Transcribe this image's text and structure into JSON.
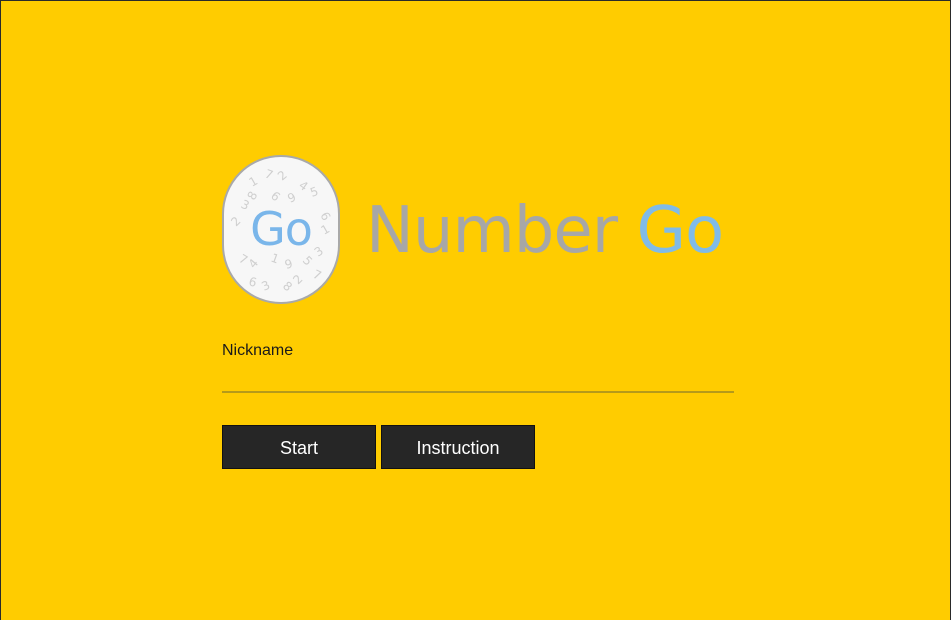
{
  "logo": {
    "badge_text": "Go",
    "badge_digits_icon": "scattered-digits-pattern"
  },
  "title": {
    "word1": "Number",
    "word2": "Go"
  },
  "form": {
    "nickname_label": "Nickname",
    "nickname_value": ""
  },
  "buttons": {
    "start_label": "Start",
    "instruction_label": "Instruction"
  },
  "colors": {
    "background": "#ffcc00",
    "accent_blue": "#7ab6ea",
    "title_gray": "#a7a7a7",
    "button_dark": "#262626"
  }
}
